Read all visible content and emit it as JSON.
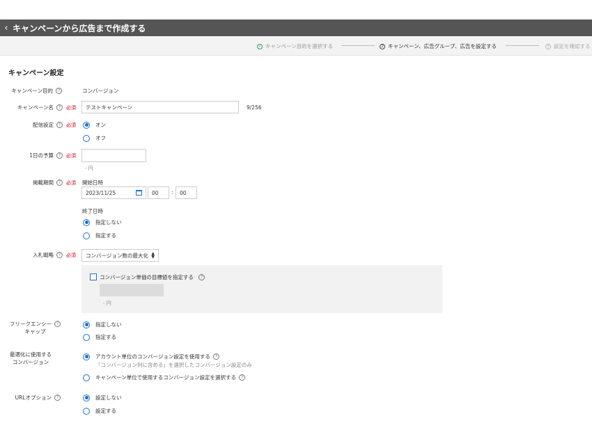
{
  "header": {
    "back_icon": "chevron-left-icon",
    "title": "キャンペーンから広告まで作成する"
  },
  "steps": [
    {
      "marker": "✓",
      "label": "キャンペーン目的を選択する",
      "state": "done"
    },
    {
      "marker": "2",
      "label": "キャンペーン、広告グループ、広告を設定する",
      "state": "current"
    },
    {
      "marker": "3",
      "label": "設定を確認する",
      "state": "pending"
    }
  ],
  "section_title": "キャンペーン設定",
  "help_icon": "?",
  "required_mark": "必須",
  "fields": {
    "objective": {
      "label": "キャンペーン目的",
      "value": "コンバージョン"
    },
    "name": {
      "label": "キャンペーン名",
      "value": "テストキャンペーン",
      "counter": "9/256"
    },
    "delivery": {
      "label": "配信設定",
      "options": [
        "オン",
        "オフ"
      ],
      "selected": 0
    },
    "budget": {
      "label": "1日の予算",
      "value": "",
      "hint": "- 円"
    },
    "period": {
      "label": "掲載期間",
      "start_label": "開始日時",
      "start_date": "2023/11/25",
      "start_hour": "00",
      "start_minute": "00",
      "time_sep": ":",
      "end_label": "終了日時",
      "end_options": [
        "指定しない",
        "指定する"
      ],
      "end_selected": 0
    },
    "bidding": {
      "label": "入札戦略",
      "selected_value": "コンバージョン数の最大化",
      "target_cpa_label": "コンバージョン単価の目標値を指定する",
      "target_cpa_checked": false,
      "target_cpa_hint": "- 円"
    },
    "frequency": {
      "label_line1": "フリークエンシー",
      "label_line2": "キャップ",
      "options": [
        "指定しない",
        "指定する"
      ],
      "selected": 0
    },
    "optimization": {
      "label_line1": "最適化に使用する",
      "label_line2": "コンバージョン",
      "options": [
        "アカウント単位のコンバージョン設定を使用する",
        "キャンペーン単位で使用するコンバージョン設定を選択する"
      ],
      "option1_note": "「コンバージョン列に含める」を選択したコンバージョン設定のみ",
      "selected": 0
    },
    "url_option": {
      "label": "URLオプション",
      "options": [
        "設定しない",
        "設定する"
      ],
      "selected": 0
    }
  },
  "colors": {
    "header_bg": "#555555",
    "accent": "#1f6fc6",
    "required": "#d0021b",
    "done": "#2e9e5b"
  }
}
